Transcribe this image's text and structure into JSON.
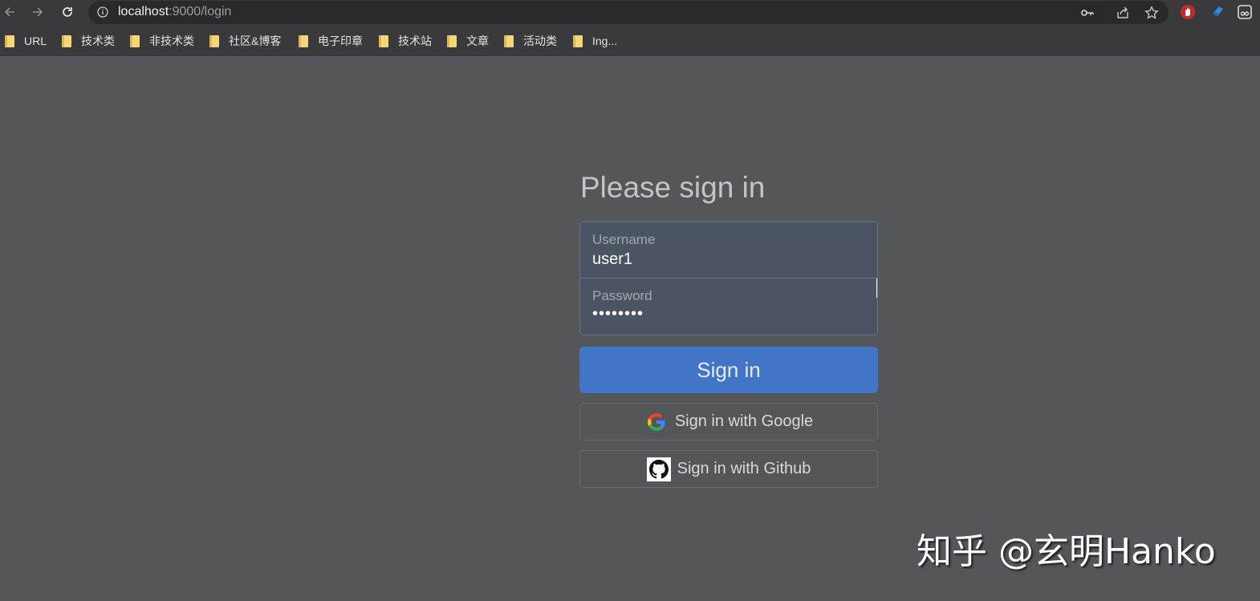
{
  "browser": {
    "url_host": "localhost",
    "url_path": ":9000/login",
    "bookmarks": [
      "URL",
      "技术类",
      "非技术类",
      "社区&博客",
      "电子印章",
      "技术站",
      "文章",
      "活动类",
      "Ing..."
    ]
  },
  "login": {
    "heading": "Please sign in",
    "username_label": "Username",
    "username_value": "user1",
    "password_label": "Password",
    "password_value": "••••••••",
    "sign_in_label": "Sign in",
    "google_label": "Sign in with Google",
    "github_label": "Sign in with Github"
  },
  "watermark": "知乎 @玄明Hanko",
  "colors": {
    "primary_button": "#4375c6",
    "page_background": "#55565a",
    "input_background": "#4b5463"
  },
  "icons": [
    "back-arrow-icon",
    "forward-arrow-icon",
    "reload-icon",
    "info-icon",
    "key-icon",
    "share-icon",
    "star-icon",
    "extension-icon",
    "folder-icon",
    "google-icon",
    "github-icon"
  ]
}
